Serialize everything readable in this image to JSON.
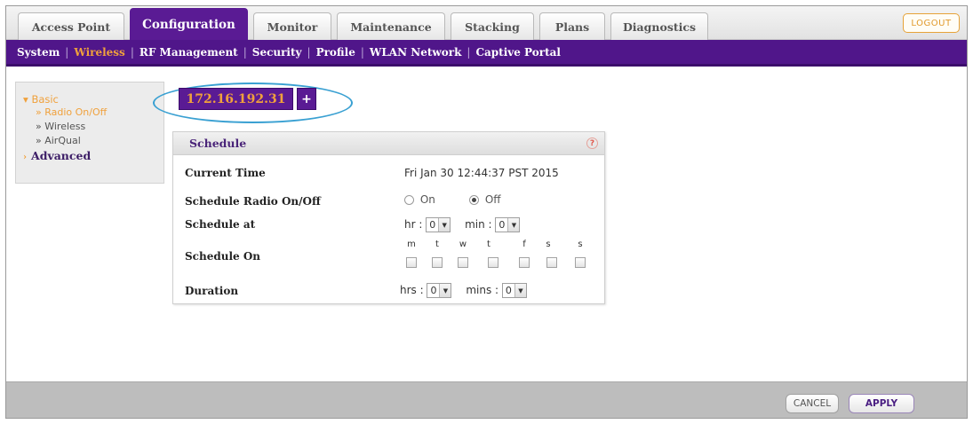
{
  "tabs": [
    {
      "label": "Access Point"
    },
    {
      "label": "Configuration"
    },
    {
      "label": "Monitor"
    },
    {
      "label": "Maintenance"
    },
    {
      "label": "Stacking"
    },
    {
      "label": "Plans"
    },
    {
      "label": "Diagnostics"
    }
  ],
  "logout_label": "LOGOUT",
  "subnav": [
    {
      "label": "System"
    },
    {
      "label": "Wireless"
    },
    {
      "label": "RF Management"
    },
    {
      "label": "Security"
    },
    {
      "label": "Profile"
    },
    {
      "label": "WLAN Network"
    },
    {
      "label": "Captive Portal"
    }
  ],
  "subnav_sep": "|",
  "leftmenu": {
    "basic": "Basic",
    "basic_arrow": "▾",
    "items": [
      {
        "label": "» Radio On/Off"
      },
      {
        "label": "» Wireless"
      },
      {
        "label": "» AirQual"
      }
    ],
    "advanced_arrow": "›",
    "advanced": "Advanced"
  },
  "ip": {
    "address": "172.16.192.31",
    "add": "+"
  },
  "panel": {
    "title": "Schedule",
    "help": "?",
    "current_time_label": "Current Time",
    "current_time_value": "Fri Jan 30 12:44:37 PST 2015",
    "radio_label": "Schedule Radio On/Off",
    "radio_on": "On",
    "radio_off": "Off",
    "schedule_at_label": "Schedule at",
    "hr_label": "hr :",
    "hr_value": "0",
    "min_label": "min :",
    "min_value": "0",
    "schedule_on_label": "Schedule On",
    "days": [
      "m",
      "t",
      "w",
      "t",
      "f",
      "s",
      "s"
    ],
    "duration_label": "Duration",
    "hrs_label": "hrs :",
    "hrs_value": "0",
    "mins_label": "mins :",
    "mins_value": "0",
    "dropdown_glyph": "▼"
  },
  "footer": {
    "cancel": "CANCEL",
    "apply": "APPLY"
  },
  "colors": {
    "brand_purple": "#5a1b94",
    "accent_orange": "#f0a13c",
    "highlight_blue": "#39a0d2"
  }
}
